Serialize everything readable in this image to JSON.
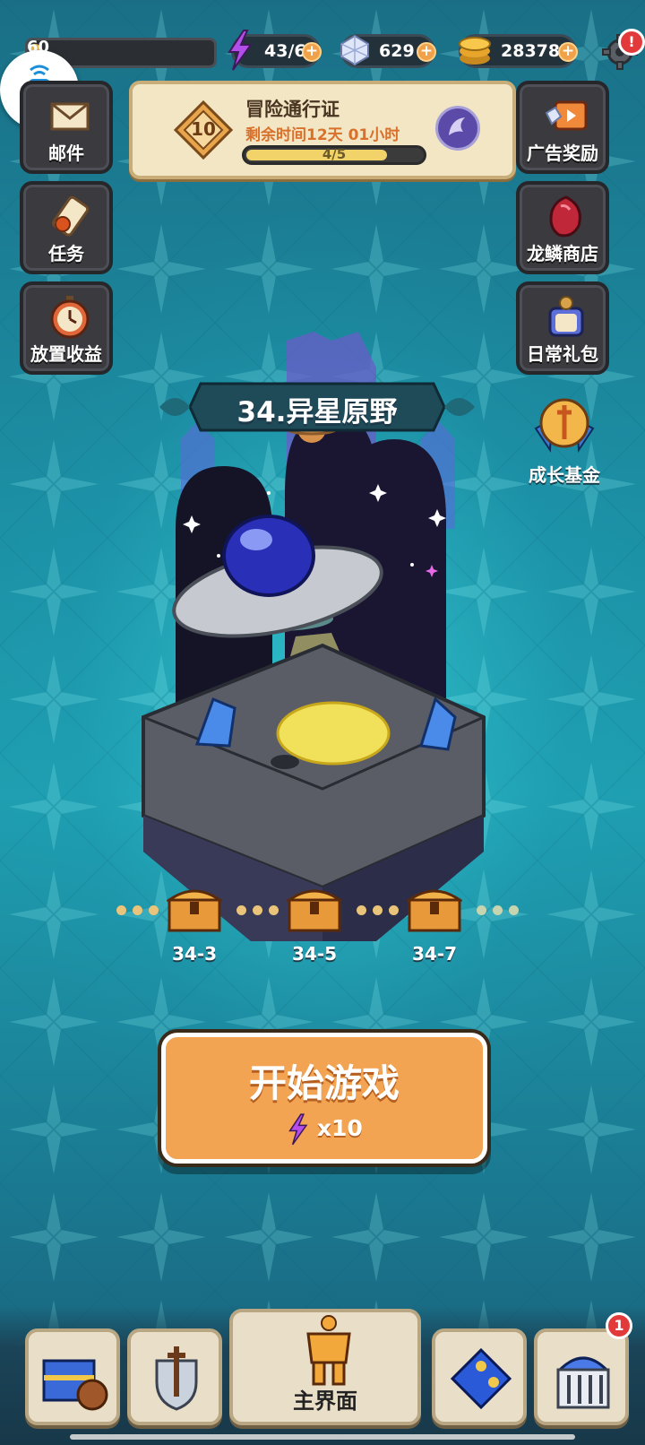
{
  "topbar": {
    "level": "60",
    "energy": "43/60",
    "gems": "629",
    "coins": "283787",
    "settings_badge": "!"
  },
  "left_menu": [
    {
      "label": "邮件",
      "icon": "mail-icon"
    },
    {
      "label": "任务",
      "icon": "scroll-icon"
    },
    {
      "label": "放置收益",
      "icon": "stopwatch-icon"
    }
  ],
  "right_menu": [
    {
      "label": "广告奖励",
      "icon": "tv-icon"
    },
    {
      "label": "龙鳞商店",
      "icon": "dragon-scale-icon"
    },
    {
      "label": "日常礼包",
      "icon": "gift-jar-icon"
    },
    {
      "label": "成长基金",
      "icon": "medal-icon"
    }
  ],
  "pass": {
    "title": "冒险通行证",
    "level": "10",
    "time_left": "剩余时间12天 01小时",
    "progress_text": "4/5",
    "progress": 0.8
  },
  "stage": {
    "title": "34.异星原野",
    "chests": [
      "34-3",
      "34-5",
      "34-7"
    ]
  },
  "start_button": {
    "label": "开始游戏",
    "cost": "x10"
  },
  "bottom_nav": {
    "main_label": "主界面",
    "badge": "1"
  },
  "colors": {
    "accent_orange": "#f2a452",
    "energy_purple": "#b44ee8",
    "gold": "#f2c84b",
    "badge_red": "#e23a3a"
  }
}
